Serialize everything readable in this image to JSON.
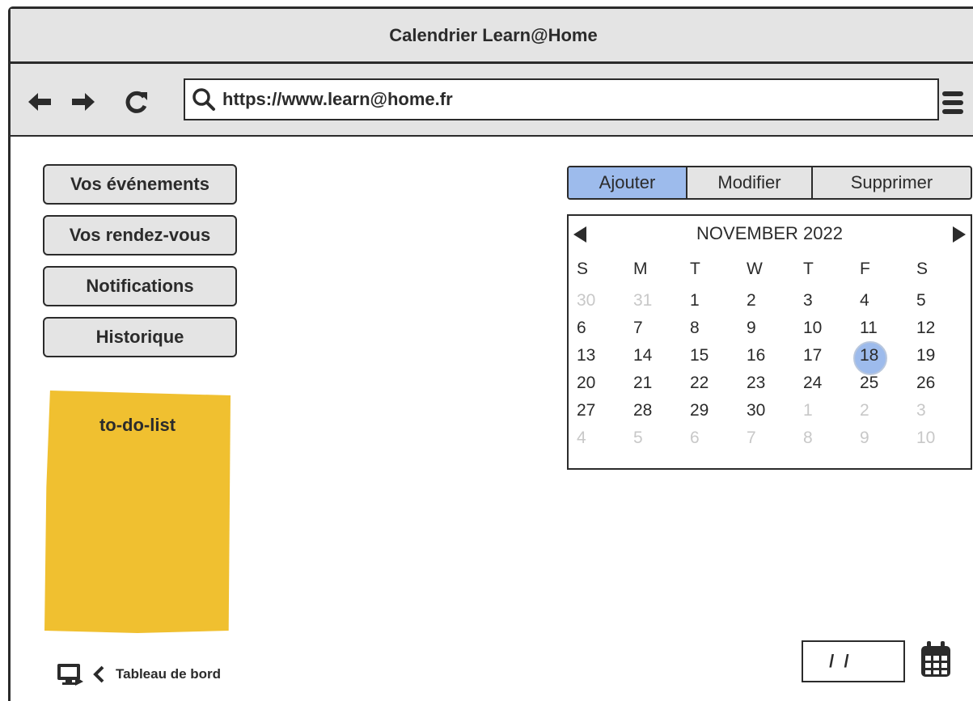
{
  "window": {
    "title": "Calendrier Learn@Home"
  },
  "browser": {
    "url": "https://www.learn@home.fr",
    "back_icon": "arrow-left-icon",
    "forward_icon": "arrow-right-icon",
    "reload_icon": "reload-icon",
    "menu_icon": "hamburger-menu-icon"
  },
  "sidebar": {
    "items": [
      {
        "label": "Vos événements"
      },
      {
        "label": "Vos rendez-vous"
      },
      {
        "label": "Notifications"
      },
      {
        "label": "Historique"
      }
    ]
  },
  "todo": {
    "title": "to-do-list",
    "color": "#f0c030"
  },
  "footer": {
    "dashboard_label": "Tableau de bord",
    "dashboard_icon": "monitor-icon"
  },
  "actions": {
    "tabs": [
      {
        "label": "Ajouter",
        "active": true
      },
      {
        "label": "Modifier",
        "active": false
      },
      {
        "label": "Supprimer",
        "active": false
      }
    ],
    "active_color": "#9dbbec"
  },
  "calendar": {
    "month_label": "NOVEMBER 2022",
    "weekdays": [
      "S",
      "M",
      "T",
      "W",
      "T",
      "F",
      "S"
    ],
    "weeks": [
      [
        "30",
        "31",
        "1",
        "2",
        "3",
        "4",
        "5"
      ],
      [
        "6",
        "7",
        "8",
        "9",
        "10",
        "11",
        "12"
      ],
      [
        "13",
        "14",
        "15",
        "16",
        "17",
        "18",
        "19"
      ],
      [
        "20",
        "21",
        "22",
        "23",
        "24",
        "25",
        "26"
      ],
      [
        "27",
        "28",
        "29",
        "30",
        "1",
        "2",
        "3"
      ],
      [
        "4",
        "5",
        "6",
        "7",
        "8",
        "9",
        "10"
      ]
    ],
    "selected_day": "18"
  },
  "date_field": {
    "value": " /  /"
  }
}
